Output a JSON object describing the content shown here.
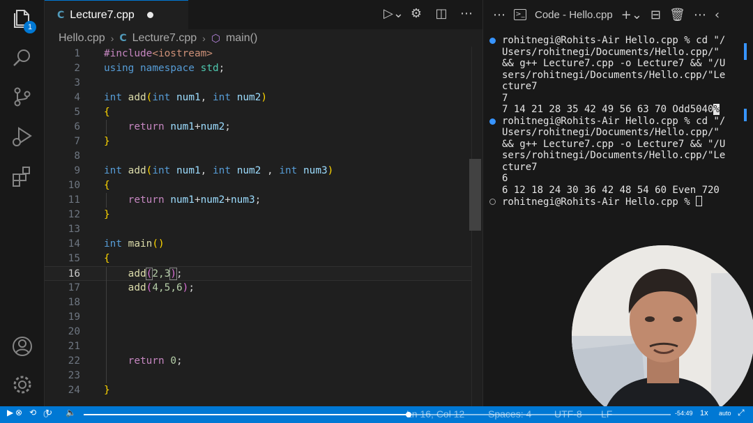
{
  "activity_bar": {
    "explorer_badge": "1",
    "icons": [
      "files-icon",
      "search-icon",
      "source-control-icon",
      "run-debug-icon",
      "extensions-icon",
      "account-icon",
      "settings-gear-icon"
    ]
  },
  "editor": {
    "tab": {
      "label": "Lecture7.cpp",
      "icon": "C"
    },
    "breadcrumb": {
      "folder": "Hello.cpp",
      "file": "Lecture7.cpp",
      "symbol": "main()"
    },
    "current_line": 16,
    "lines": [
      {
        "n": "1"
      },
      {
        "n": "2"
      },
      {
        "n": "3"
      },
      {
        "n": "4"
      },
      {
        "n": "5"
      },
      {
        "n": "6"
      },
      {
        "n": "7"
      },
      {
        "n": "8"
      },
      {
        "n": "9"
      },
      {
        "n": "10"
      },
      {
        "n": "11"
      },
      {
        "n": "12"
      },
      {
        "n": "13"
      },
      {
        "n": "14"
      },
      {
        "n": "15"
      },
      {
        "n": "16"
      },
      {
        "n": "17"
      },
      {
        "n": "18"
      },
      {
        "n": "19"
      },
      {
        "n": "20"
      },
      {
        "n": "21"
      },
      {
        "n": "22"
      },
      {
        "n": "23"
      },
      {
        "n": "24"
      }
    ],
    "code": {
      "l1_directive": "#include",
      "l1_header": "<iostream>",
      "l2_using": "using",
      "l2_namespace": "namespace",
      "l2_std": "std",
      "l2_semi": ";",
      "int": "int",
      "add": "add",
      "num1": "num1",
      "num2": "num2",
      "num3": "num3",
      "comma": ",",
      "comma_sp": " , ",
      "open_paren": "(",
      "close_paren": ")",
      "open_brace": "{",
      "close_brace": "}",
      "return": "return",
      "plus": "+",
      "semi": ";",
      "main": "main",
      "l16_args": "2,3",
      "l17_args": "4,5,6",
      "zero": "0"
    }
  },
  "terminal": {
    "title": "Code - Hello.cpp",
    "lines": [
      "rohitnegi@Rohits-Air Hello.cpp % cd \"/",
      "Users/rohitnegi/Documents/Hello.cpp/\"",
      "&& g++ Lecture7.cpp -o Lecture7 && \"/U",
      "sers/rohitnegi/Documents/Hello.cpp/\"Le",
      "cture7",
      "7",
      "7 14 21 28 35 42 49 56 63 70 Odd5040",
      "rohitnegi@Rohits-Air Hello.cpp % cd \"/",
      "Users/rohitnegi/Documents/Hello.cpp/\"",
      "&& g++ Lecture7.cpp -o Lecture7 && \"/U",
      "sers/rohitnegi/Documents/Hello.cpp/\"Le",
      "cture7",
      "6",
      "6 12 18 24 30 36 42 48 54 60 Even 720",
      "rohitnegi@Rohits-Air Hello.cpp % "
    ],
    "percent_marker": "%"
  },
  "status_bar": {
    "errors": "0",
    "cursor_position": "Ln 16, Col 12",
    "spaces": "Spaces: 4",
    "encoding": "UTF-8",
    "eol": "LF"
  },
  "video_player": {
    "progress": 0.553,
    "time_remaining": "-54:49",
    "speed": "1x",
    "quality": "auto"
  },
  "colors": {
    "accent": "#0078d4",
    "keyword": "#569cd6",
    "function": "#dcdcaa",
    "string": "#ce9178",
    "number": "#b5cea8",
    "bracket": "#ffd700"
  }
}
